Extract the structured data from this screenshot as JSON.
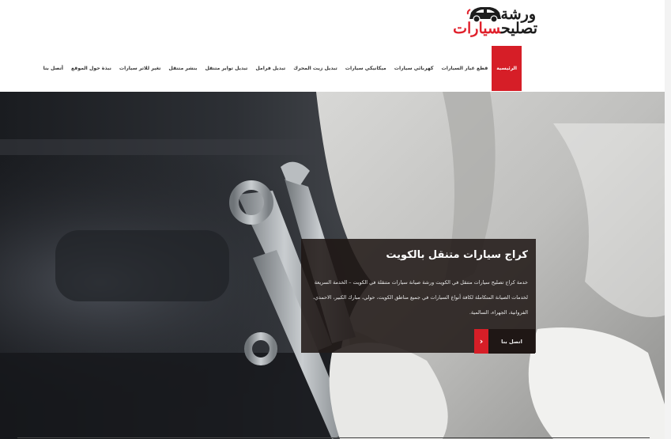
{
  "brand": {
    "logo_line1": "ورشة",
    "logo_line2_dark": "تصليح",
    "logo_line2_red": "سيارات",
    "logo_icon": "car-icon",
    "accent_color": "#d61e27"
  },
  "nav": {
    "items": [
      {
        "label": "الرئيسية",
        "active": true
      },
      {
        "label": "قطع غيار السيارات"
      },
      {
        "label": "كهربائي سيارات"
      },
      {
        "label": "ميكانيكي سيارات"
      },
      {
        "label": "تبديل زيت المحرك"
      },
      {
        "label": "تبديل فرامل"
      },
      {
        "label": "تبديل تواير متنقل"
      },
      {
        "label": "بنشر متنقل"
      },
      {
        "label": "تغير للاتر سيارات"
      },
      {
        "label": "نبذة حول الموقع"
      },
      {
        "label": "أتصل بنا"
      }
    ]
  },
  "hero": {
    "title": "كراج سيارات متنقل بالكويت",
    "text": "خدمة كراج تصليح سيارات متنقل في الكويت ورشة صيانة سيارات متنقلة في الكويت – الخدمة السريعة لخدمات الصيانة المتكاملة لكافة أنواع السيارات في جميع مناطق الكويت، حولي، مبارك الكبير، الاحمدي، الفروانية، الجهراء، السالمية.",
    "cta_label": "اتصل بنا",
    "cta_icon": "chevron-right-icon"
  }
}
